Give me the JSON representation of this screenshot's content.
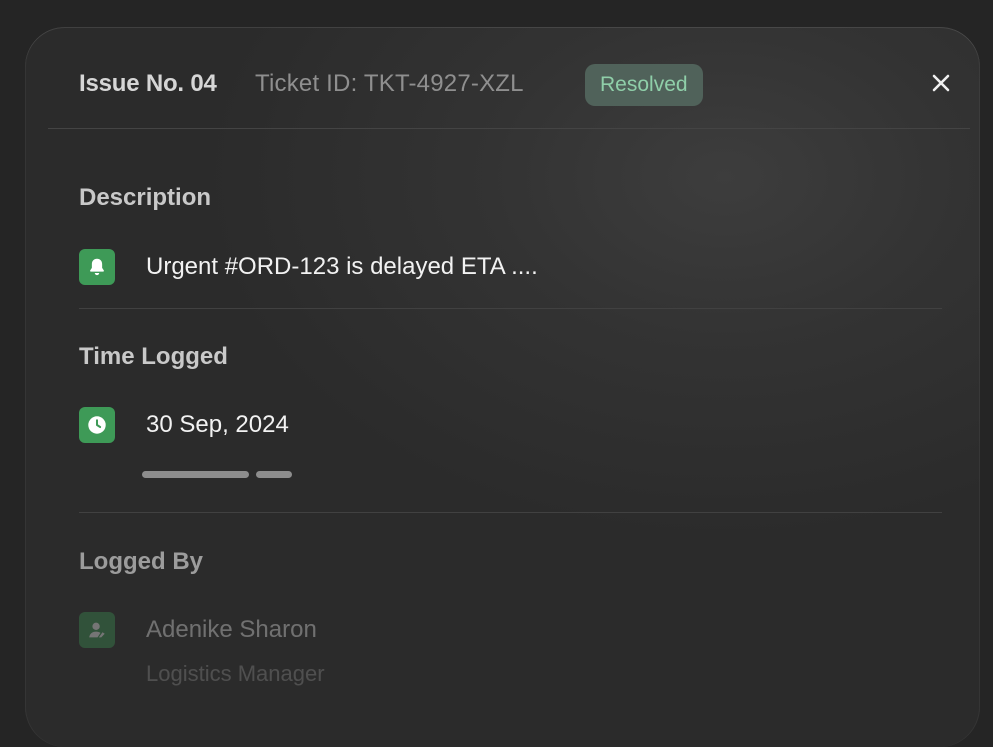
{
  "header": {
    "issue_title": "Issue No. 04",
    "ticket_id": "Ticket ID: TKT-4927-XZL",
    "status": "Resolved"
  },
  "description": {
    "title": "Description",
    "icon": "bell-icon",
    "text": "Urgent #ORD-123 is delayed ETA ...."
  },
  "time_logged": {
    "title": "Time Logged",
    "icon": "clock-icon",
    "date": "30 Sep, 2024"
  },
  "logged_by": {
    "title": "Logged By",
    "icon": "user-icon",
    "name": "Adenike Sharon",
    "role": "Logistics Manager"
  },
  "colors": {
    "accent_green": "#3e9a57",
    "badge_bg": "#50625a",
    "badge_text": "#8fcfa9"
  }
}
